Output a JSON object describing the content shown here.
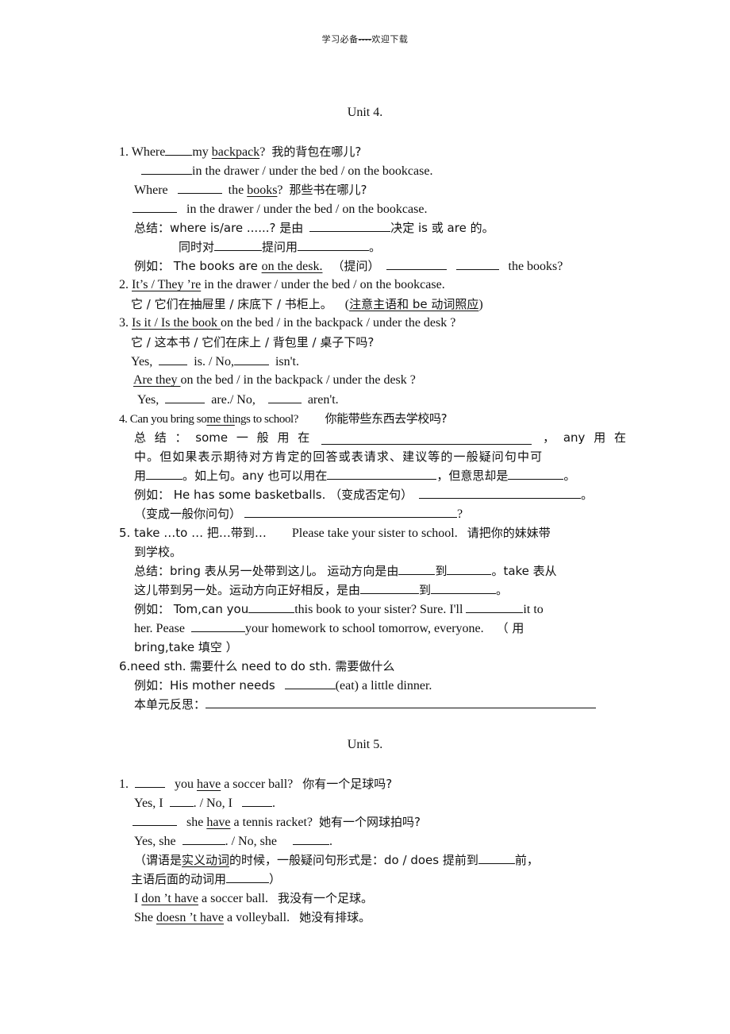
{
  "header": {
    "left": "学习必备",
    "dashes": "----",
    "right": "欢迎下载"
  },
  "unit4": {
    "title": "Unit 4.",
    "l1": {
      "num": "1. Where",
      "a": "my",
      "b": "backpack",
      "c": "?",
      "cn": "我的背包在哪儿?"
    },
    "l2": {
      "text": "in the drawer / under the bed / on the bookcase."
    },
    "l3": {
      "a": "Where",
      "b": "the",
      "c": "books",
      "d": "?",
      "cn": "那些书在哪儿?"
    },
    "l4": {
      "text": "in the drawer / under the bed / on the bookcase."
    },
    "l5": {
      "a": "总结：where is/are ......? 是由",
      "b": "决定 is  或 are 的。"
    },
    "l6": {
      "a": "同时对",
      "b": "提问用",
      "c": "。"
    },
    "l7": {
      "a": "例如：  The books are ",
      "b": "on the desk.",
      "c": "（提问）",
      "d": "the books?"
    },
    "l8": {
      "num": "2. ",
      "a": "It’s / They ’re",
      "b": " in the drawer / under the bed / on the bookcase."
    },
    "l9": {
      "a": "它 / 它们在抽屉里 / 床底下 / 书柜上。",
      "b": "(",
      "c": "注意主语和 be 动词照应",
      "d": ")"
    },
    "l10": {
      "num": "3. ",
      "a": "Is it / Is the book ",
      "b": "on the bed / in the backpack / under the desk ?"
    },
    "l11": {
      "text": "它 / 这本书 / 它们在床上 / 背包里 / 桌子下吗?"
    },
    "l12": {
      "a": "Yes,",
      "b": "is.    /    No,",
      "c": "isn't."
    },
    "l13": {
      "a": "Are they ",
      "b": "on the bed / in the backpack / under the desk ?"
    },
    "l14": {
      "a": "Yes,",
      "b": "are./ No,",
      "c": "aren't."
    },
    "l15": {
      "num": "4. Can you bring so",
      "a": "me thi",
      "b": "ngs to school?",
      "cn": "你能带些东西去学校吗?"
    },
    "l16": {
      "a": "总 结 ： some  一 般 用 在",
      "b": "，  any   用 在"
    },
    "l17": {
      "text": "中。但如果表示期待对方肯定的回答或表请求、建议等的一般疑问句中可"
    },
    "l18": {
      "a": "用",
      "b": "。如上句。any  也可以用在",
      "c": "，但意思却是",
      "d": "。"
    },
    "l19": {
      "a": "例如：  He has some  basketballs. （变成否定句）",
      "b": "。"
    },
    "l20": {
      "a": "（变成一般你问句）",
      "b": "?"
    },
    "l21": {
      "a": "5. take …to …  把…带到…",
      "b": "Please take your sister to school.",
      "c": "请把你的妹妹带"
    },
    "l22": {
      "text": "到学校。"
    },
    "l23": {
      "a": "总结：bring  表从另一处带到这儿。 运动方向是由",
      "b": "到",
      "c": "。take  表从"
    },
    "l24": {
      "a": "这儿带到另一处。运动方向正好相反，是由",
      "b": "到",
      "c": "。"
    },
    "l25": {
      "a": "例如：   Tom,can  you",
      "b": "this  book  to  your  sister?  Sure.  I'll",
      "c": "it  to"
    },
    "l26": {
      "a": "her.   Pease",
      "b": "your   homework    to   school   tomorrow,    everyone.",
      "c": "（ 用"
    },
    "l27": {
      "text": "bring,take  填空 ）"
    },
    "l28": {
      "a": "6.need sth.  需要什么  need to do sth.    需要做什么"
    },
    "l29": {
      "a": "例如：His mother needs",
      "b": "(eat) a little dinner."
    },
    "l30": {
      "a": "本单元反思："
    }
  },
  "unit5": {
    "title": "Unit 5.",
    "l1": {
      "num": "1.",
      "a": "you",
      "b": "have",
      "c": " a soccer ball?",
      "cn": "你有一个足球吗?"
    },
    "l2": {
      "a": "Yes, I",
      "b": ". / No, I",
      "c": "."
    },
    "l3": {
      "a": "she",
      "b": "have",
      "c": " a tennis racket?",
      "cn": "她有一个网球拍吗?"
    },
    "l4": {
      "a": "Yes, she",
      "b": ". / No, she",
      "c": "."
    },
    "l5": {
      "a": "（谓语是",
      "b": "实义动词",
      "c": "的时候，一般疑问句形式是：do / does  提前到",
      "d": "前，"
    },
    "l6": {
      "a": "主语后面的动词用",
      "b": "）"
    },
    "l7": {
      "a": "I ",
      "b": "don ’t have",
      "c": " a soccer ball.",
      "cn": "我没有一个足球。"
    },
    "l8": {
      "a": "She ",
      "b": "doesn ’t have",
      "c": " a volleyball.",
      "cn": "她没有排球。"
    }
  }
}
